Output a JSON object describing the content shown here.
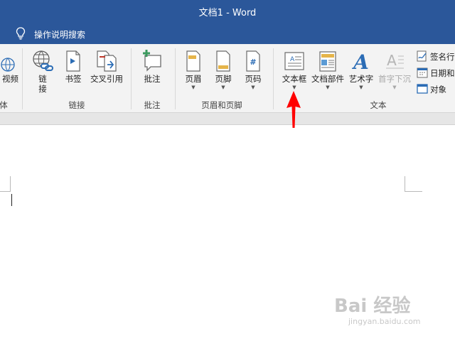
{
  "window": {
    "title": "文档1  -  Word"
  },
  "tell_me": {
    "text": "操作说明搜索",
    "icon": "lightbulb-icon"
  },
  "ribbon": {
    "partial_group": {
      "button_label": "视频",
      "group_label": "体"
    },
    "links_group": {
      "label": "链接",
      "buttons": [
        {
          "name": "link",
          "label": "链\n接",
          "icon": "globe-link-icon"
        },
        {
          "name": "bookmark",
          "label": "书签",
          "icon": "bookmark-icon"
        },
        {
          "name": "cross-reference",
          "label": "交叉引用",
          "icon": "cross-reference-icon"
        }
      ]
    },
    "comments_group": {
      "label": "批注",
      "buttons": [
        {
          "name": "comment",
          "label": "批注",
          "icon": "comment-add-icon"
        }
      ]
    },
    "header_footer_group": {
      "label": "页眉和页脚",
      "buttons": [
        {
          "name": "header",
          "label": "页眉",
          "icon": "header-icon"
        },
        {
          "name": "footer",
          "label": "页脚",
          "icon": "footer-icon"
        },
        {
          "name": "page-number",
          "label": "页码",
          "icon": "page-number-icon"
        }
      ]
    },
    "text_group": {
      "label": "文本",
      "buttons": [
        {
          "name": "text-box",
          "label": "文本框",
          "icon": "text-box-icon"
        },
        {
          "name": "quick-parts",
          "label": "文档部件",
          "icon": "quick-parts-icon"
        },
        {
          "name": "wordart",
          "label": "艺术字",
          "icon": "wordart-icon"
        },
        {
          "name": "drop-cap",
          "label": "首字下沉",
          "icon": "drop-cap-icon",
          "disabled": true
        }
      ],
      "small_buttons": [
        {
          "name": "signature-line",
          "label": "签名行",
          "icon": "signature-icon"
        },
        {
          "name": "date-time",
          "label": "日期和",
          "icon": "calendar-icon"
        },
        {
          "name": "object",
          "label": "对象",
          "icon": "object-icon"
        }
      ]
    }
  },
  "annotation": {
    "arrow_color": "#ff0000",
    "points_to": "text-box"
  },
  "watermark": {
    "text": "Bai 经验",
    "sub": "jingyan.baidu.com"
  },
  "colors": {
    "title_bar": "#2b579a",
    "ribbon_bg": "#f3f3f3",
    "document_bg": "#ffffff"
  }
}
